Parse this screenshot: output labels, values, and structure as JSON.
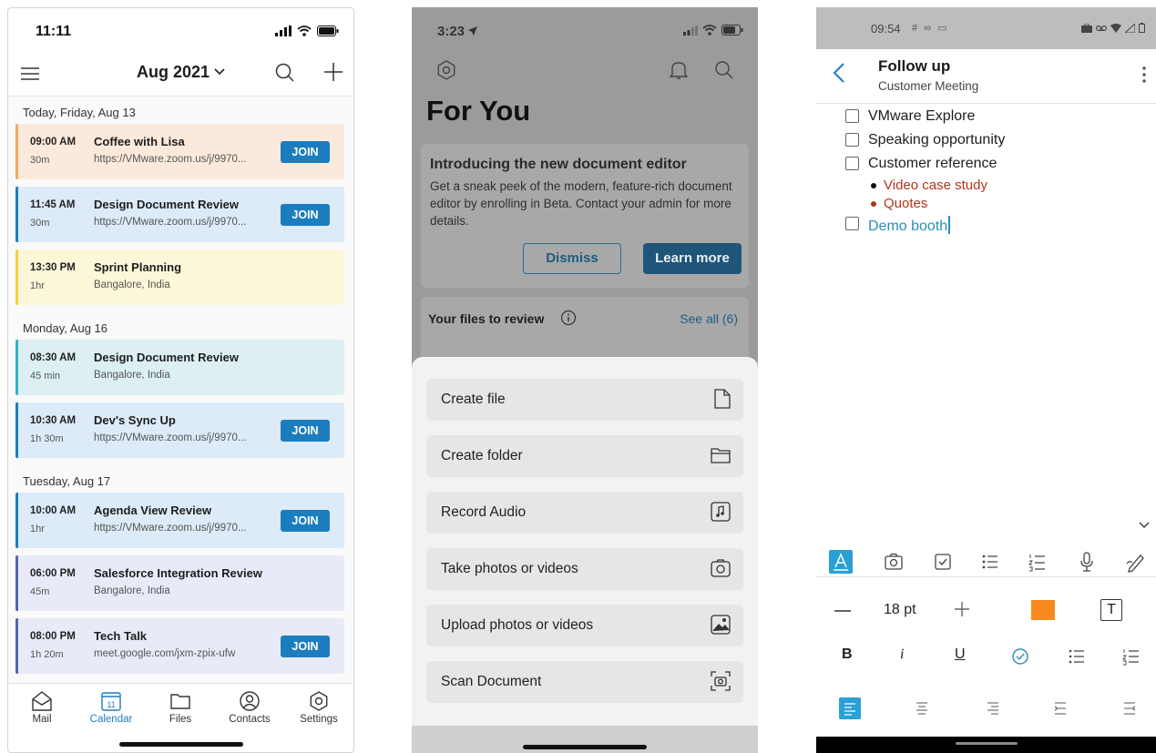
{
  "calendar": {
    "status_time": "11:11",
    "title": "Aug 2021",
    "days": [
      {
        "label": "Today, Friday, Aug 13",
        "events": [
          {
            "time": "09:00 AM",
            "duration": "30m",
            "title": "Coffee with Lisa",
            "location": "https://VMware.zoom.us/j/9970...",
            "join": "JOIN",
            "bg": "#fbeadc",
            "bar": "#f0a96a"
          },
          {
            "time": "11:45 AM",
            "duration": "30m",
            "title": "Design Document Review",
            "location": "https://VMware.zoom.us/j/9970...",
            "join": "JOIN",
            "bg": "#dcebf7",
            "bar": "#1c7dbe"
          },
          {
            "time": "13:30 PM",
            "duration": "1hr",
            "title": "Sprint Planning",
            "location": "Bangalore, India",
            "join": "",
            "bg": "#fdf7d9",
            "bar": "#f1d33d"
          }
        ]
      },
      {
        "label": "Monday, Aug 16",
        "events": [
          {
            "time": "08:30 AM",
            "duration": "45 min",
            "title": "Design Document Review",
            "location": "Bangalore, India",
            "join": "",
            "bg": "#dcf0f3",
            "bar": "#2eb3c4"
          },
          {
            "time": "10:30 AM",
            "duration": "1h 30m",
            "title": "Dev's Sync Up",
            "location": "https://VMware.zoom.us/j/9970...",
            "join": "JOIN",
            "bg": "#dcebf7",
            "bar": "#1c7dbe"
          }
        ]
      },
      {
        "label": "Tuesday, Aug 17",
        "events": [
          {
            "time": "10:00 AM",
            "duration": "1hr",
            "title": "Agenda View Review",
            "location": "https://VMware.zoom.us/j/9970...",
            "join": "JOIN",
            "bg": "#dcebf7",
            "bar": "#1c7dbe"
          },
          {
            "time": "06:00 PM",
            "duration": "45m",
            "title": "Salesforce Integration Review",
            "location": "Bangalore, India",
            "join": "",
            "bg": "#e8ebf7",
            "bar": "#5663a8"
          },
          {
            "time": "08:00 PM",
            "duration": "1h 20m",
            "title": "Tech Talk",
            "location": "meet.google.com/jxm-zpix-ufw",
            "join": "JOIN",
            "bg": "#e8ebf7",
            "bar": "#5663a8"
          }
        ]
      }
    ],
    "tabs": {
      "mail": "Mail",
      "calendar": "Calendar",
      "calendar_day": "11",
      "files": "Files",
      "contacts": "Contacts",
      "settings": "Settings"
    },
    "accent": "#1c7dbe"
  },
  "files_app": {
    "status_time": "3:23",
    "heading": "For You",
    "card": {
      "title": "Introducing the new document editor",
      "body": "Get a sneak peek of the modern, feature-rich document editor by enrolling in Beta. Contact your admin for more details.",
      "dismiss": "Dismiss",
      "learn_more": "Learn more"
    },
    "review": {
      "title": "Your files to review",
      "see_all": "See all (6)"
    },
    "sheet_items": [
      {
        "label": "Create file",
        "icon": "file-icon"
      },
      {
        "label": "Create folder",
        "icon": "folder-icon"
      },
      {
        "label": "Record Audio",
        "icon": "audio-file-icon"
      },
      {
        "label": "Take photos or videos",
        "icon": "camera-icon"
      },
      {
        "label": "Upload photos or videos",
        "icon": "image-icon"
      },
      {
        "label": "Scan Document",
        "icon": "scan-icon"
      }
    ]
  },
  "notes_app": {
    "status_time": "09:54",
    "status_icons": "# ∞ ▭",
    "title": "Follow up",
    "subtitle": "Customer Meeting",
    "items": [
      {
        "text": "VMware Explore"
      },
      {
        "text": "Speaking opportunity"
      },
      {
        "text": "Customer reference"
      }
    ],
    "bullets": [
      "Video case study",
      "Quotes"
    ],
    "last_item": "Demo booth",
    "font_size": "18 pt",
    "text_box_label": "T",
    "bold_label": "B",
    "italic_label": "i",
    "underline_label": "U",
    "bullet_color": "#b5341c",
    "highlight_color": "#f7891f"
  }
}
